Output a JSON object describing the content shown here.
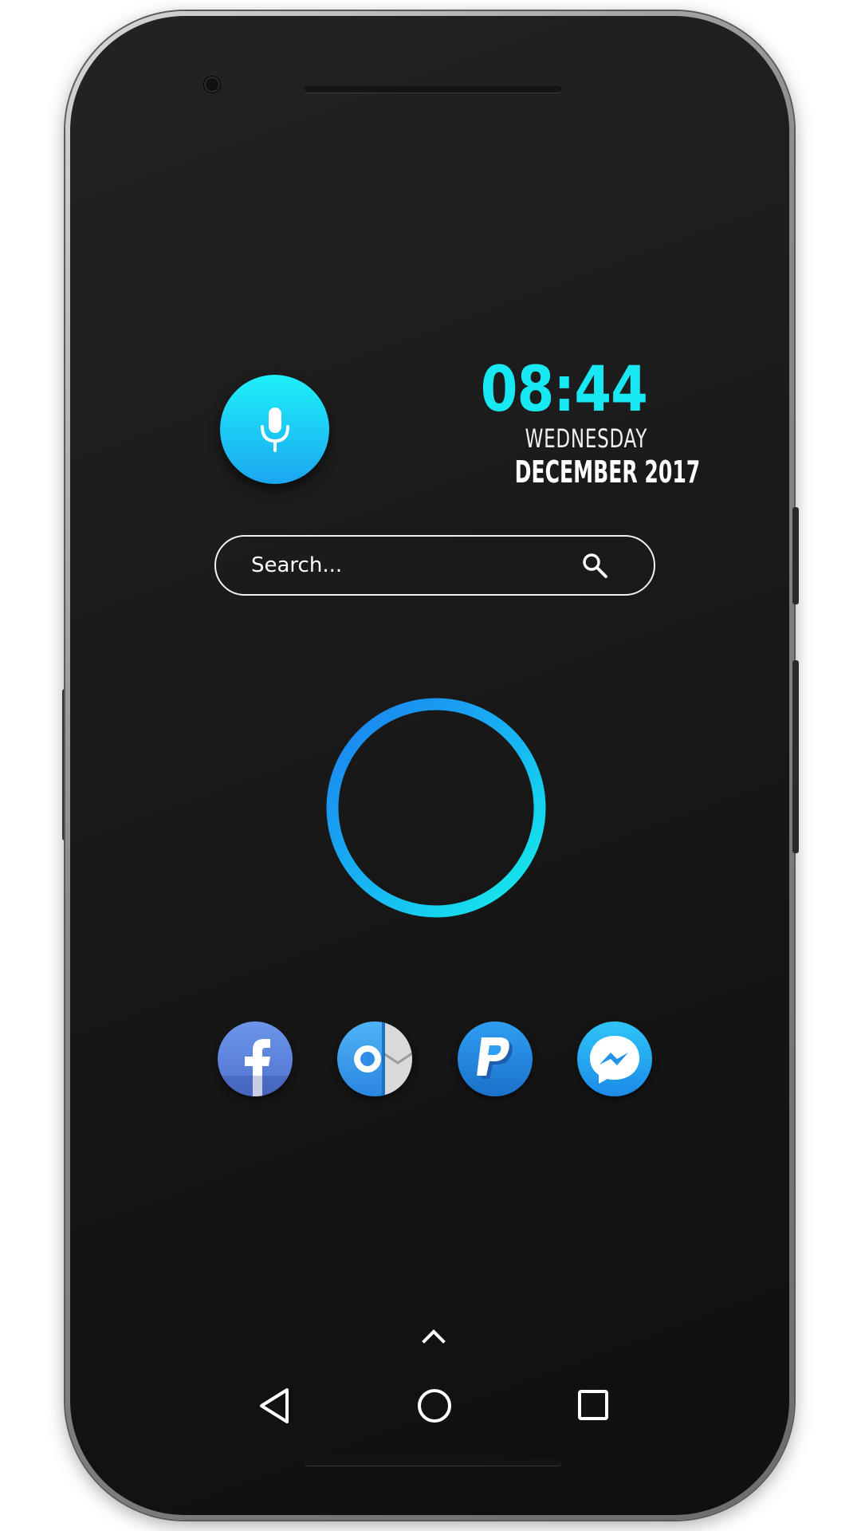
{
  "clock": {
    "time": "08:44",
    "day": "WEDNESDAY",
    "date": "DECEMBER 2017",
    "color": "#17e8f1"
  },
  "search": {
    "placeholder": "Search..."
  },
  "mic": {
    "icon": "microphone-icon",
    "color": "#1ecff6"
  },
  "dock": {
    "apps": [
      {
        "name": "Facebook",
        "icon": "facebook-icon"
      },
      {
        "name": "Outlook",
        "icon": "outlook-icon"
      },
      {
        "name": "PayPal",
        "icon": "paypal-icon"
      },
      {
        "name": "Messenger",
        "icon": "messenger-icon"
      }
    ]
  },
  "navigation": {
    "drawer": "chevron-up-icon",
    "back": "back-triangle-icon",
    "home": "home-circle-icon",
    "recent": "recent-square-icon"
  },
  "ring": {
    "gradient_start": "#1d8df0",
    "gradient_end": "#18f0ea"
  }
}
